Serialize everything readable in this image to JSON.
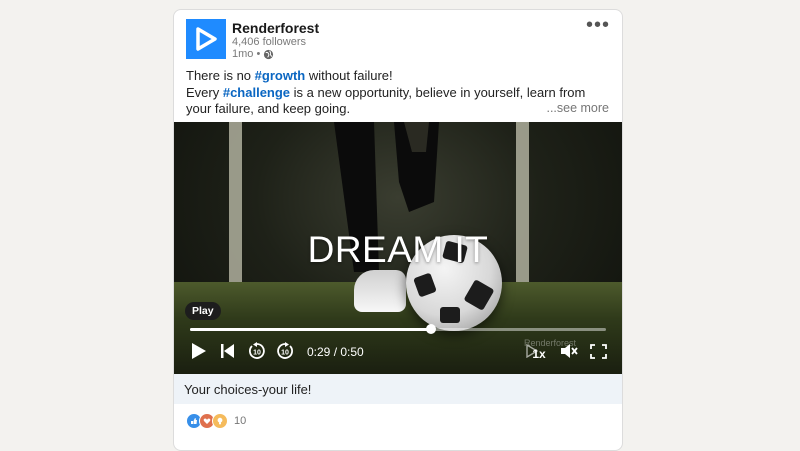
{
  "post": {
    "author": "Renderforest",
    "followers": "4,406 followers",
    "age": "1mo •",
    "text_line1_prefix": "There is no ",
    "hashtag1": "#growth",
    "text_line1_suffix": " without failure!",
    "text_line2_prefix": "Every ",
    "hashtag2": "#challenge",
    "text_line2_suffix": " is a new opportunity, believe in yourself, learn from your failure, and keep going.",
    "see_more": "...see more"
  },
  "video": {
    "overlay_title": "DREAM IT",
    "tooltip": "Play",
    "current_time": "0:29",
    "duration": "0:50",
    "time_display": "0:29 / 0:50",
    "progress_fraction": 0.58,
    "speed": "1x",
    "watermark": "Renderforest",
    "rewind_seconds": "10",
    "forward_seconds": "10"
  },
  "caption": "Your choices-your life!",
  "reactions": {
    "count": "10",
    "icons": [
      "like-icon",
      "love-icon",
      "insightful-icon"
    ]
  },
  "icons": {
    "logo": "renderforest-logo-icon",
    "more": "more-options-icon",
    "visibility": "globe-icon",
    "play": "play-icon",
    "skip_back": "skip-back-icon",
    "rewind": "rewind-10-icon",
    "forward": "forward-10-icon",
    "captions": "captions-icon",
    "volume": "muted-volume-icon",
    "fullscreen": "fullscreen-icon"
  },
  "colors": {
    "brand": "#1f8bff",
    "hashtag": "#0a66c2",
    "caption_bg": "#eef3f8"
  }
}
